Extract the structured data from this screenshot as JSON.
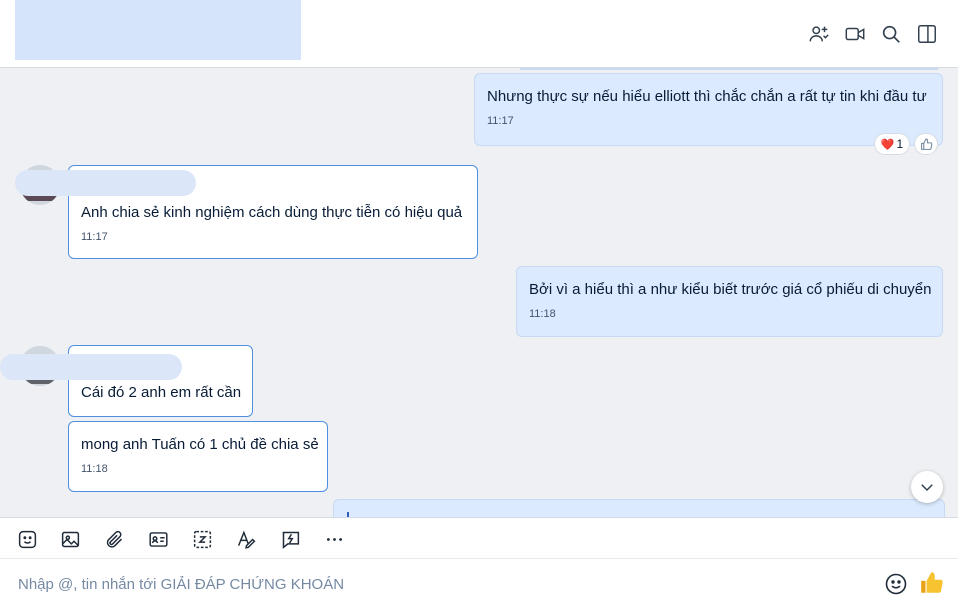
{
  "header": {
    "icons": [
      "add-member-icon",
      "video-call-icon",
      "search-icon",
      "sidebar-toggle-icon"
    ]
  },
  "messages": [
    {
      "direction": "out",
      "text": "Nhưng thực sự nếu hiểu elliott thì chắc chắn a rất tự tin khi đầu tư",
      "time": "11:17",
      "reaction": {
        "emoji": "❤️",
        "count": "1"
      }
    },
    {
      "direction": "in",
      "text": "Anh chia sẻ kinh nghiệm cách dùng thực tiễn có hiệu quả",
      "time": "11:17"
    },
    {
      "direction": "out",
      "text": "Bởi vì a hiểu thì a như kiểu biết trước giá cổ phiếu di chuyển",
      "time": "11:18"
    },
    {
      "direction": "in",
      "text": "Cái đó 2 anh em rất cần",
      "time": ""
    },
    {
      "direction": "in",
      "text": "mong anh Tuấn có 1 chủ đề chia sẻ",
      "time": "11:18"
    }
  ],
  "toolbar": {
    "icons": [
      "sticker-icon",
      "image-icon",
      "attachment-icon",
      "contact-card-icon",
      "screenshot-icon",
      "text-format-icon",
      "quick-message-icon",
      "more-icon"
    ]
  },
  "composer": {
    "placeholder": "Nhập @, tin nhắn tới GIẢI ĐÁP CHỨNG KHOÁN",
    "value": ""
  },
  "colors": {
    "outgoing_bubble": "#dbeafe",
    "incoming_border": "#4d8fe0",
    "like_accent": "#f5a623"
  }
}
